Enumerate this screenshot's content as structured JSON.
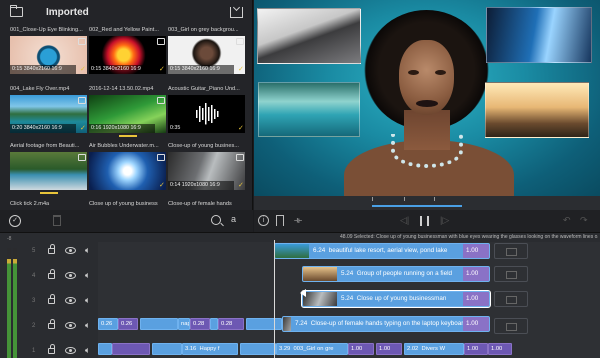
{
  "media_browser": {
    "title": "Imported",
    "clips": [
      {
        "name": "001_Close-Up Eye Blinking...",
        "meta": "0:15  3840x2160  16:9"
      },
      {
        "name": "002_Red and Yellow Paint...",
        "meta": "0:15  3840x2160  16:9"
      },
      {
        "name": "003_Girl on grey backgrou...",
        "meta": "0:15  3840x2160  16:9"
      },
      {
        "name": "004_Lake Fly Over.mp4",
        "meta": "0:20  3840x2160  16:9"
      },
      {
        "name": "2016-12-14 13.50.02.mp4",
        "meta": "0:16  1920x1080  16:9"
      },
      {
        "name": "Acoustic Guitar_Piano Und...",
        "meta": "0:35"
      },
      {
        "name": "Aerial footage from Beauti...",
        "meta": ""
      },
      {
        "name": "Air Bubbles Underwater.m...",
        "meta": ""
      },
      {
        "name": "Close-up of young busines...",
        "meta": "0:14  1920x1080  16:9"
      },
      {
        "name": "Click tick 2.m4a",
        "meta": ""
      },
      {
        "name": "Close up of young business",
        "meta": ""
      },
      {
        "name": "Close-up of female hands",
        "meta": ""
      }
    ],
    "footer": {
      "sort_label": "a"
    }
  },
  "viewer": {
    "controls": {
      "info": "i",
      "split": "⟛",
      "prev": "◁|",
      "next": "|▷",
      "undo": "↶",
      "redo": "↷"
    }
  },
  "timeline": {
    "meter_label": "-8",
    "info_text": "48.09 Selected: Close up of young businessman with blue eyes wearing the glasses looking on the waveform lines o...",
    "tracks": [
      {
        "number": "5"
      },
      {
        "number": "4"
      },
      {
        "number": "3"
      },
      {
        "number": "2"
      },
      {
        "number": "1"
      }
    ],
    "clips": [
      {
        "duration": "6.24",
        "label": "beautiful lake resort, aerial view, pond lake",
        "fx": "1.00"
      },
      {
        "duration": "5.24",
        "label": "Group of people running on a field",
        "fx": "1.00"
      },
      {
        "duration": "5.24",
        "label": "Close up of young businessman",
        "fx": "1.00"
      },
      {
        "duration": "7.24",
        "label": "Close-up of female hands typing on the laptop keyboard",
        "fx": "1.00"
      }
    ],
    "small_clips": {
      "a": "0.26",
      "b": "0.26",
      "c": "0.28",
      "d": "0.26",
      "e": "0.28",
      "f": "3.16",
      "g": "Happy f",
      "h": "3.29",
      "i": "003_Girl on gre",
      "j": "1.00",
      "k": "1.00",
      "l": "2.02",
      "m": "Divers W",
      "n": "1.00",
      "o": "1.00",
      "p": "nap"
    }
  }
}
